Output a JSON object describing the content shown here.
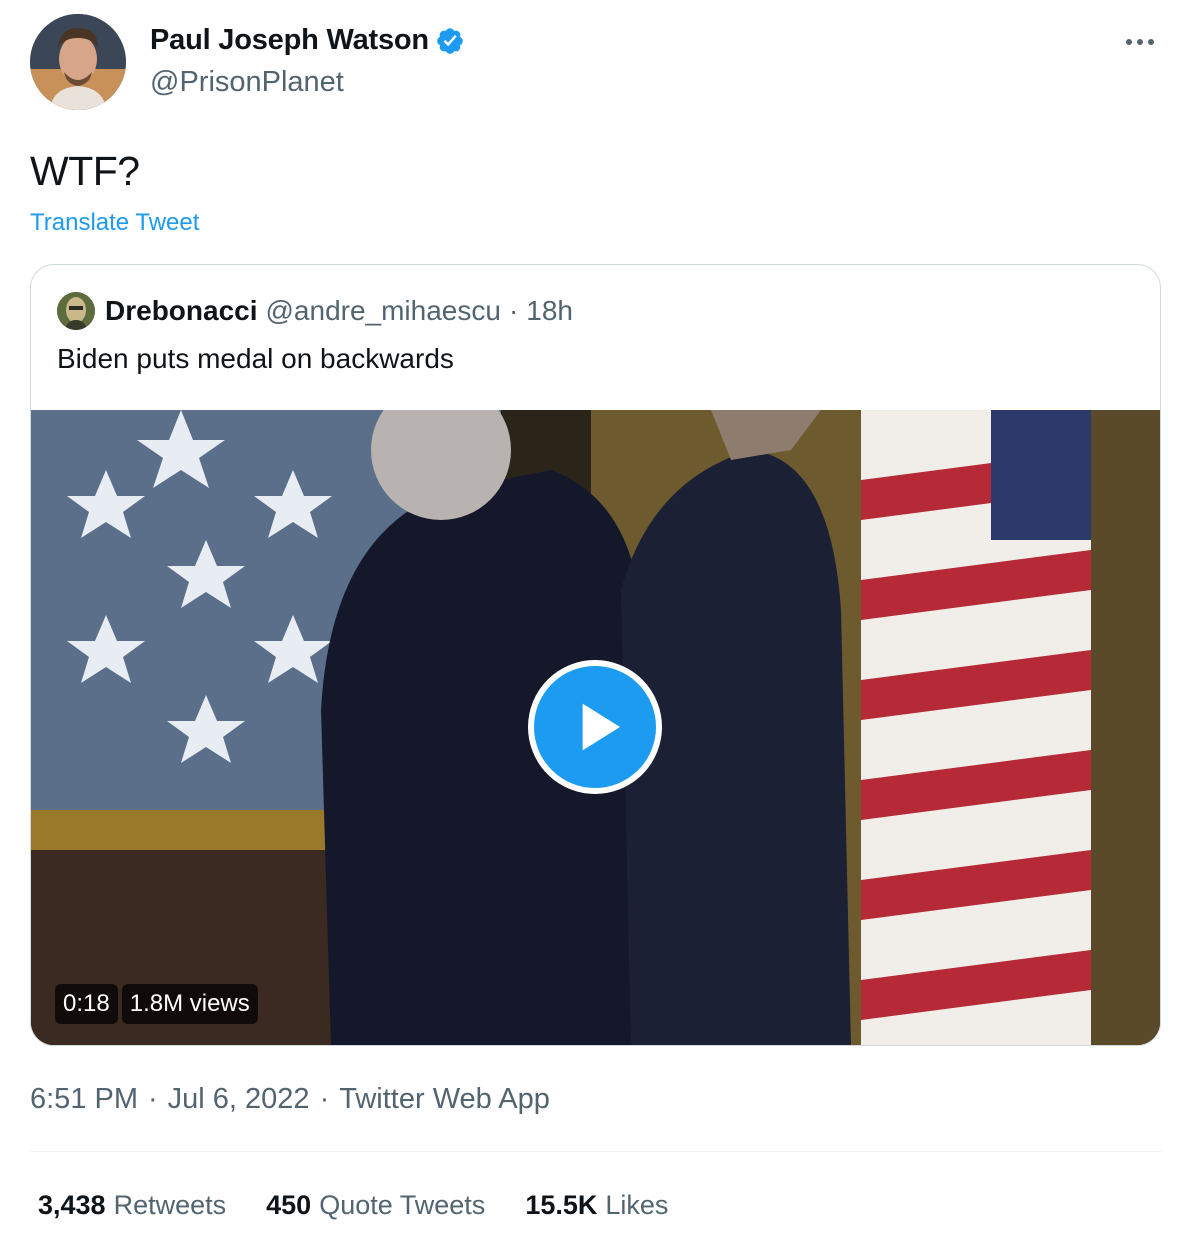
{
  "author": {
    "display_name": "Paul Joseph Watson",
    "handle": "@PrisonPlanet",
    "avatar_icon": "profile-photo",
    "verified_icon": "verified-badge-icon"
  },
  "tweet": {
    "text": "WTF?",
    "translate_label": "Translate Tweet"
  },
  "quoted": {
    "display_name": "Drebonacci",
    "handle": "@andre_mihaescu",
    "separator": "·",
    "time": "18h",
    "text": "Biden puts medal on backwards",
    "media": {
      "duration": "0:18",
      "views": "1.8M views",
      "play_icon": "play-icon"
    }
  },
  "meta": {
    "time": "6:51 PM",
    "separator": "·",
    "date": "Jul 6, 2022",
    "source": "Twitter Web App"
  },
  "stats": [
    {
      "count": "3,438",
      "label": "Retweets"
    },
    {
      "count": "450",
      "label": "Quote Tweets"
    },
    {
      "count": "15.5K",
      "label": "Likes"
    }
  ],
  "colors": {
    "accent": "#1d9bf0",
    "secondary_text": "#536471",
    "primary_text": "#0f1419",
    "border": "#cfd9de"
  }
}
